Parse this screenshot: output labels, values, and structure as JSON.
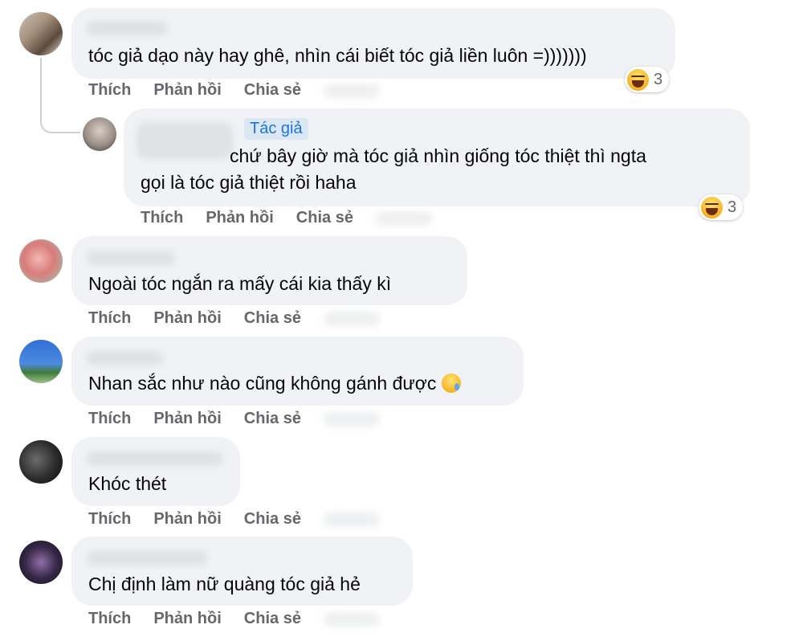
{
  "comments": [
    {
      "text": "tóc giả dạo này hay ghê, nhìn cái biết tóc giả liền luôn =)))))))",
      "reaction_count": "3",
      "reaction_icon": "haha-icon"
    },
    {
      "author_badge": "Tác giả",
      "text_line1": "chứ bây giờ mà tóc giả nhìn giống tóc thiệt thì ngta",
      "text_line2": "gọi là tóc giả thiệt rồi haha",
      "reaction_count": "3",
      "reaction_icon": "haha-icon"
    },
    {
      "text": "Ngoài tóc ngắn ra mấy cái kia thấy kì"
    },
    {
      "text": "Nhan sắc như nào cũng không gánh được",
      "emoji": "crying-smile-emoji"
    },
    {
      "text": "Khóc thét"
    },
    {
      "text": "Chị định làm nữ quàng tóc giả hẻ"
    }
  ],
  "actions": {
    "like": "Thích",
    "reply": "Phản hồi",
    "share": "Chia sẻ"
  },
  "colors": {
    "bubble": "#f0f2f5",
    "action_text": "#65676b",
    "author_badge": "#1b74e4"
  }
}
